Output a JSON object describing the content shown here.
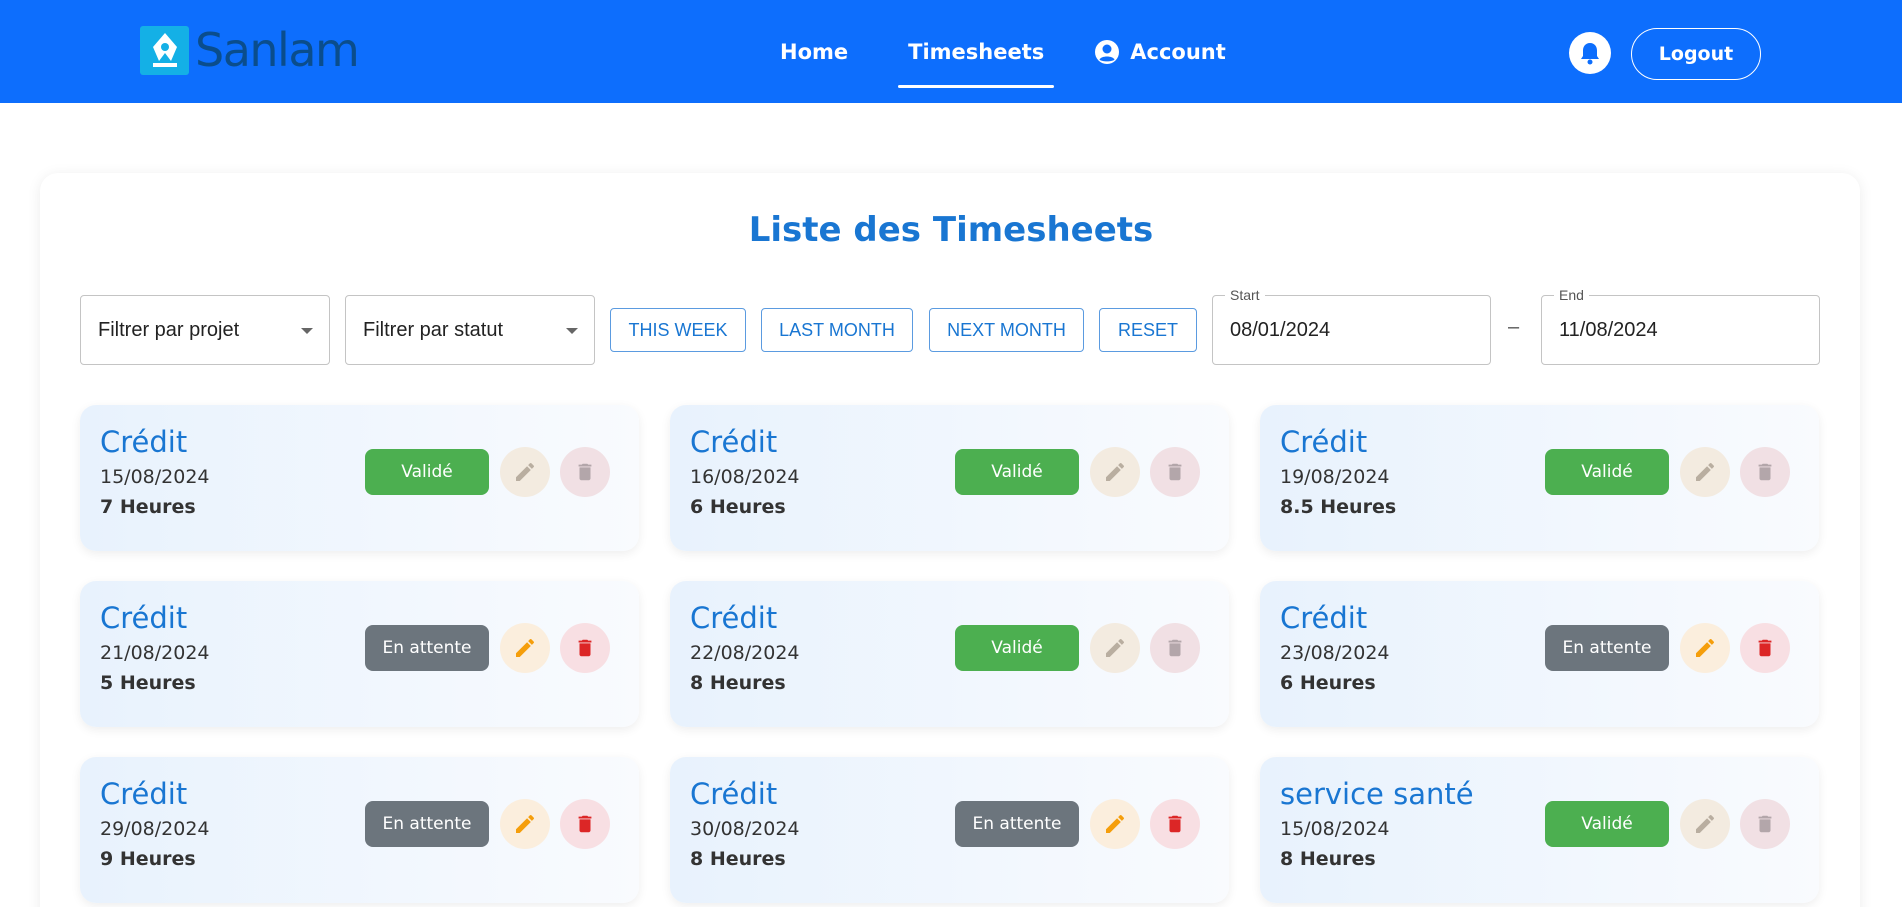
{
  "brand": {
    "name": "Sanlam",
    "logo_color": "#14b0e6",
    "text_color": "#0a4d8c"
  },
  "nav": {
    "bg": "#0d6efd",
    "home": "Home",
    "timesheets": "Timesheets",
    "account": "Account",
    "logout": "Logout",
    "active": "Timesheets"
  },
  "main": {
    "title": "Liste des Timesheets",
    "filters": {
      "project_placeholder": "Filtrer par projet",
      "status_placeholder": "Filtrer par statut",
      "this_week": "THIS WEEK",
      "last_month": "LAST MONTH",
      "next_month": "NEXT MONTH",
      "reset": "RESET",
      "start_label": "Start",
      "start_value": "08/01/2024",
      "separator": "–",
      "end_label": "End",
      "end_value": "11/08/2024"
    },
    "cards": [
      {
        "project": "Crédit",
        "date": "15/08/2024",
        "hours": "7 Heures",
        "status": "Validé",
        "editable": false
      },
      {
        "project": "Crédit",
        "date": "16/08/2024",
        "hours": "6 Heures",
        "status": "Validé",
        "editable": false
      },
      {
        "project": "Crédit",
        "date": "19/08/2024",
        "hours": "8.5 Heures",
        "status": "Validé",
        "editable": false
      },
      {
        "project": "Crédit",
        "date": "21/08/2024",
        "hours": "5 Heures",
        "status": "En attente",
        "editable": true
      },
      {
        "project": "Crédit",
        "date": "22/08/2024",
        "hours": "8 Heures",
        "status": "Validé",
        "editable": false
      },
      {
        "project": "Crédit",
        "date": "23/08/2024",
        "hours": "6 Heures",
        "status": "En attente",
        "editable": true
      },
      {
        "project": "Crédit",
        "date": "29/08/2024",
        "hours": "9 Heures",
        "status": "En attente",
        "editable": true
      },
      {
        "project": "Crédit",
        "date": "30/08/2024",
        "hours": "8 Heures",
        "status": "En attente",
        "editable": true
      },
      {
        "project": "service santé",
        "date": "15/08/2024",
        "hours": "8 Heures",
        "status": "Validé",
        "editable": false
      }
    ]
  },
  "colors": {
    "accent": "#1976d2",
    "validated": "#4caf50",
    "pending": "#6c757d",
    "edit_on": "#f59e0b",
    "edit_off": "#b9aea0",
    "delete_on": "#dc2626",
    "delete_off": "#b3a6aa"
  },
  "icons": [
    "home-icon",
    "account-circle-icon",
    "bell-icon",
    "pencil-icon",
    "trash-icon",
    "caret-down-icon"
  ]
}
